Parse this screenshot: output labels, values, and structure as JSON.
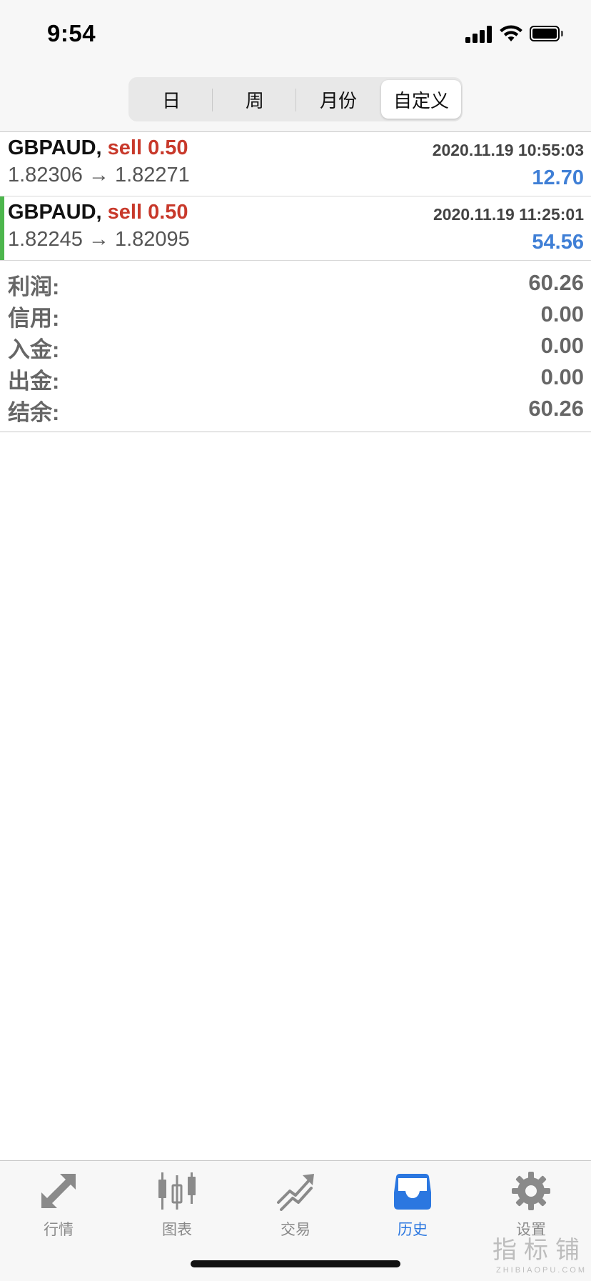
{
  "status_bar": {
    "time": "9:54"
  },
  "period_tabs": [
    {
      "label": "日",
      "active": false
    },
    {
      "label": "周",
      "active": false
    },
    {
      "label": "月份",
      "active": false
    },
    {
      "label": "自定义",
      "active": true
    }
  ],
  "trades": [
    {
      "symbol": "GBPAUD,",
      "direction": "sell 0.50",
      "timestamp": "2020.11.19 10:55:03",
      "prices": "1.82306 → 1.82271",
      "profit": "12.70"
    },
    {
      "symbol": "GBPAUD,",
      "direction": "sell 0.50",
      "timestamp": "2020.11.19 11:25:01",
      "prices": "1.82245 → 1.82095",
      "profit": "54.56"
    }
  ],
  "summary": [
    {
      "label": "利润:",
      "value": "60.26"
    },
    {
      "label": "信用:",
      "value": "0.00"
    },
    {
      "label": "入金:",
      "value": "0.00"
    },
    {
      "label": "出金:",
      "value": "0.00"
    },
    {
      "label": "结余:",
      "value": "60.26"
    }
  ],
  "tab_bar": [
    {
      "label": "行情",
      "icon": "quotes-arrows-icon",
      "active": false
    },
    {
      "label": "图表",
      "icon": "candlestick-chart-icon",
      "active": false
    },
    {
      "label": "交易",
      "icon": "trade-trend-icon",
      "active": false
    },
    {
      "label": "历史",
      "icon": "history-inbox-icon",
      "active": true
    },
    {
      "label": "设置",
      "icon": "gear-icon",
      "active": false
    }
  ],
  "watermark": {
    "text": "指标铺",
    "sub": "ZHIBIAOPU.COM"
  },
  "colors": {
    "sell": "#c8392b",
    "profit": "#3f7fd6",
    "accent_bar": "#4cb64c",
    "tab_active": "#2b77e0",
    "tab_inactive": "#8a8a8a"
  }
}
